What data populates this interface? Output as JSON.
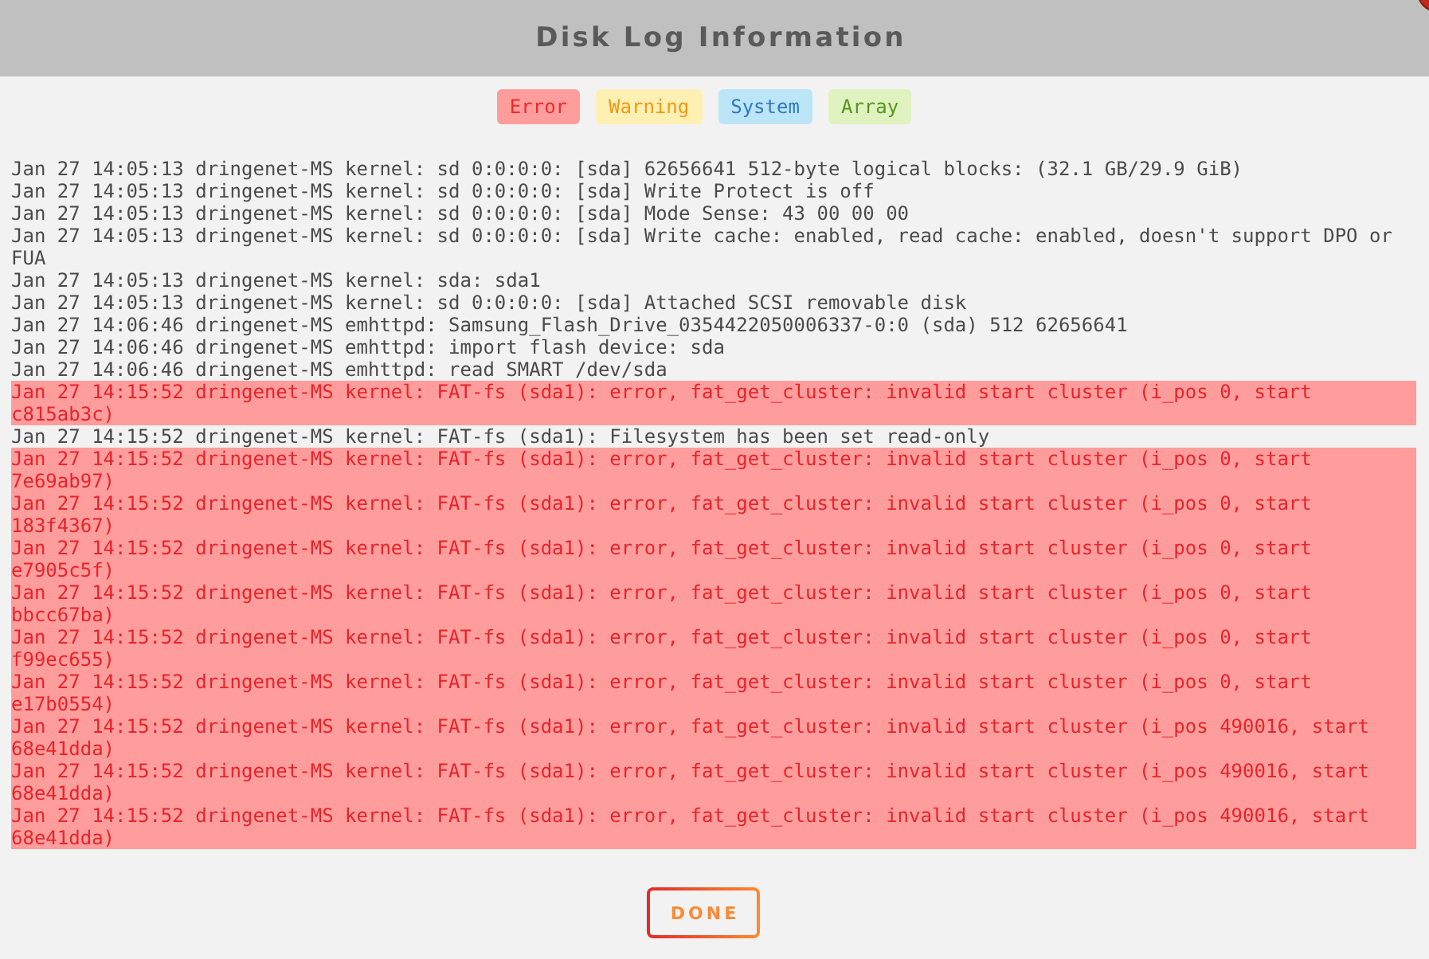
{
  "window": {
    "title": "Disk Log Information"
  },
  "legend": [
    {
      "label": "Error",
      "kind": "error",
      "color": "#ff9d9d"
    },
    {
      "label": "Warning",
      "kind": "warning",
      "color": "#feefb3"
    },
    {
      "label": "System",
      "kind": "system",
      "color": "#bde5f8"
    },
    {
      "label": "Array",
      "kind": "array",
      "color": "#dff2bf"
    }
  ],
  "log": [
    {
      "text": "Jan 27 14:05:13 dringenet-MS kernel: sd 0:0:0:0: [sda] 62656641 512-byte logical blocks: (32.1 GB/29.9 GiB)",
      "kind": "plain"
    },
    {
      "text": "Jan 27 14:05:13 dringenet-MS kernel: sd 0:0:0:0: [sda] Write Protect is off",
      "kind": "plain"
    },
    {
      "text": "Jan 27 14:05:13 dringenet-MS kernel: sd 0:0:0:0: [sda] Mode Sense: 43 00 00 00",
      "kind": "plain"
    },
    {
      "text": "Jan 27 14:05:13 dringenet-MS kernel: sd 0:0:0:0: [sda] Write cache: enabled, read cache: enabled, doesn't support DPO or FUA",
      "kind": "plain"
    },
    {
      "text": "Jan 27 14:05:13 dringenet-MS kernel: sda: sda1",
      "kind": "plain"
    },
    {
      "text": "Jan 27 14:05:13 dringenet-MS kernel: sd 0:0:0:0: [sda] Attached SCSI removable disk",
      "kind": "plain"
    },
    {
      "text": "Jan 27 14:06:46 dringenet-MS emhttpd: Samsung_Flash_Drive_0354422050006337-0:0 (sda) 512 62656641",
      "kind": "plain"
    },
    {
      "text": "Jan 27 14:06:46 dringenet-MS emhttpd: import flash device: sda",
      "kind": "plain"
    },
    {
      "text": "Jan 27 14:06:46 dringenet-MS emhttpd: read SMART /dev/sda",
      "kind": "plain"
    },
    {
      "text": "Jan 27 14:15:52 dringenet-MS kernel: FAT-fs (sda1): error, fat_get_cluster: invalid start cluster (i_pos 0, start c815ab3c)",
      "kind": "error"
    },
    {
      "text": "Jan 27 14:15:52 dringenet-MS kernel: FAT-fs (sda1): Filesystem has been set read-only",
      "kind": "plain"
    },
    {
      "text": "Jan 27 14:15:52 dringenet-MS kernel: FAT-fs (sda1): error, fat_get_cluster: invalid start cluster (i_pos 0, start 7e69ab97)",
      "kind": "error"
    },
    {
      "text": "Jan 27 14:15:52 dringenet-MS kernel: FAT-fs (sda1): error, fat_get_cluster: invalid start cluster (i_pos 0, start 183f4367)",
      "kind": "error"
    },
    {
      "text": "Jan 27 14:15:52 dringenet-MS kernel: FAT-fs (sda1): error, fat_get_cluster: invalid start cluster (i_pos 0, start e7905c5f)",
      "kind": "error"
    },
    {
      "text": "Jan 27 14:15:52 dringenet-MS kernel: FAT-fs (sda1): error, fat_get_cluster: invalid start cluster (i_pos 0, start bbcc67ba)",
      "kind": "error"
    },
    {
      "text": "Jan 27 14:15:52 dringenet-MS kernel: FAT-fs (sda1): error, fat_get_cluster: invalid start cluster (i_pos 0, start f99ec655)",
      "kind": "error"
    },
    {
      "text": "Jan 27 14:15:52 dringenet-MS kernel: FAT-fs (sda1): error, fat_get_cluster: invalid start cluster (i_pos 0, start e17b0554)",
      "kind": "error"
    },
    {
      "text": "Jan 27 14:15:52 dringenet-MS kernel: FAT-fs (sda1): error, fat_get_cluster: invalid start cluster (i_pos 490016, start 68e41dda)",
      "kind": "error"
    },
    {
      "text": "Jan 27 14:15:52 dringenet-MS kernel: FAT-fs (sda1): error, fat_get_cluster: invalid start cluster (i_pos 490016, start 68e41dda)",
      "kind": "error"
    },
    {
      "text": "Jan 27 14:15:52 dringenet-MS kernel: FAT-fs (sda1): error, fat_get_cluster: invalid start cluster (i_pos 490016, start 68e41dda)",
      "kind": "error"
    }
  ],
  "buttons": [
    {
      "label": "DONE"
    }
  ]
}
